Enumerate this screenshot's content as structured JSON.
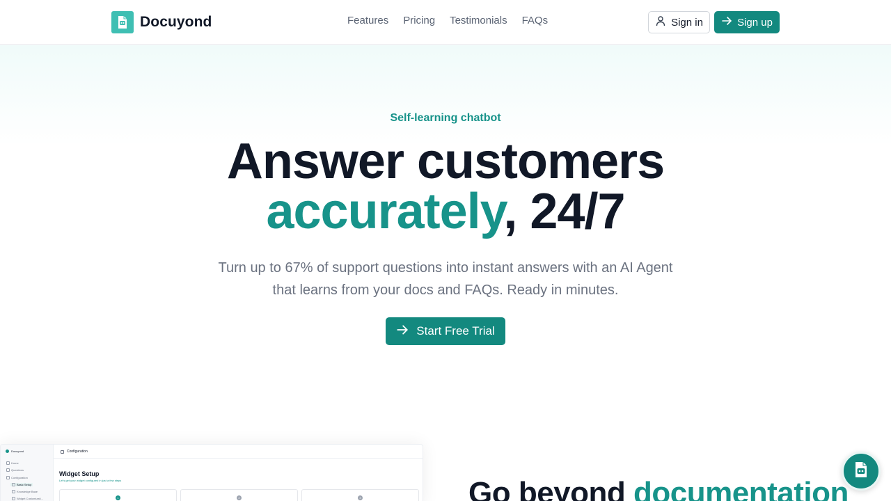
{
  "header": {
    "brand": "Docuyond",
    "nav": [
      "Features",
      "Pricing",
      "Testimonials",
      "FAQs"
    ],
    "signin_label": "Sign in",
    "signup_label": "Sign up"
  },
  "hero": {
    "eyebrow": "Self-learning chatbot",
    "headline_line1": "Answer customers",
    "headline_accent": "accurately",
    "headline_rest": ", 24/7",
    "subtitle": "Turn up to 67% of support questions into instant answers with an AI Agent that learns from your docs and FAQs. Ready in minutes.",
    "cta_label": "Start Free Trial"
  },
  "preview": {
    "brand": "Docuyond",
    "topbar_title": "Configuration",
    "sidebar_items": [
      "Home",
      "Questions",
      "Configuration",
      "Basic Setup",
      "Knowledge Base",
      "Widget Customizati..."
    ],
    "title": "Widget Setup",
    "subtitle": "Let's get your widget configured in just a few steps",
    "steps": [
      "1",
      "2",
      "3"
    ]
  },
  "section2": {
    "heading": "Go beyond ",
    "heading_accent": "documentation"
  },
  "colors": {
    "accent": "#17938a",
    "button": "#13897f",
    "text_dark": "#111827",
    "text_muted": "#6b7280"
  },
  "icons": {
    "logo": "robot-document-icon",
    "signin": "user-icon",
    "signup": "arrow-right-icon",
    "cta": "arrow-right-icon",
    "chat": "robot-icon"
  }
}
